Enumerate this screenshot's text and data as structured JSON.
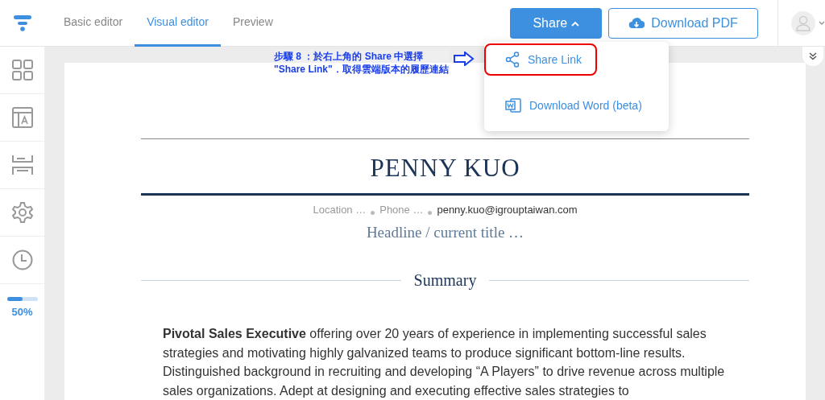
{
  "tabs": [
    {
      "label": "Basic editor",
      "selected": false
    },
    {
      "label": "Visual editor",
      "selected": true
    },
    {
      "label": "Preview",
      "selected": false
    }
  ],
  "share_button": {
    "label": "Share",
    "expanded": true
  },
  "download_pdf_button": {
    "label": "Download PDF"
  },
  "share_menu": {
    "items": [
      {
        "kind": "share",
        "label": "Share Link",
        "highlighted": true
      },
      {
        "kind": "word",
        "label": "Download Word (beta)",
        "highlighted": false
      }
    ]
  },
  "annotation": {
    "lines": [
      "步驟 8 ：於右上角的 Share 中選擇",
      "\"Share Link\"．取得雲端版本的履歷連結"
    ]
  },
  "sidebar": {
    "items": [
      {
        "kind": "grid"
      },
      {
        "kind": "template"
      },
      {
        "kind": "sections"
      },
      {
        "kind": "settings"
      },
      {
        "kind": "history"
      }
    ],
    "progress": {
      "level": 0.5,
      "reading": "50%"
    }
  },
  "resume": {
    "name": "PENNY KUO",
    "contact": [
      {
        "text": "Location …",
        "filled": false
      },
      {
        "text": "Phone …",
        "filled": false
      },
      {
        "text": "penny.kuo@igrouptaiwan.com",
        "filled": true
      }
    ],
    "headline": "Headline / current title …",
    "section_title": "Summary",
    "summary": "**Pivotal Sales Executive** offering over 20 years of experience in implementing successful sales strategies and motivating highly galvanized teams to produce significant bottom-line results. Distinguished background in recruiting and developing “A Players” to drive revenue across multiple sales organizations. Adept at designing and executing effective sales strategies to"
  }
}
